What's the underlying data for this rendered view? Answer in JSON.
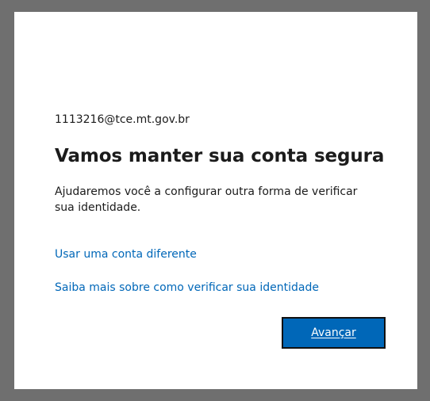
{
  "account": {
    "email": "1113216@tce.mt.gov.br"
  },
  "header": {
    "title": "Vamos manter sua conta segura"
  },
  "body": {
    "description": "Ajudaremos você a configurar outra forma de verificar sua identidade."
  },
  "links": {
    "different_account": "Usar uma conta diferente",
    "learn_more": "Saiba mais sobre como verificar sua identidade"
  },
  "actions": {
    "next_label": "Avançar"
  },
  "colors": {
    "background": "#6f6f6f",
    "card": "#ffffff",
    "text": "#1b1b1b",
    "link": "#0067b8",
    "button": "#0067b8",
    "button_text": "#ffffff"
  }
}
